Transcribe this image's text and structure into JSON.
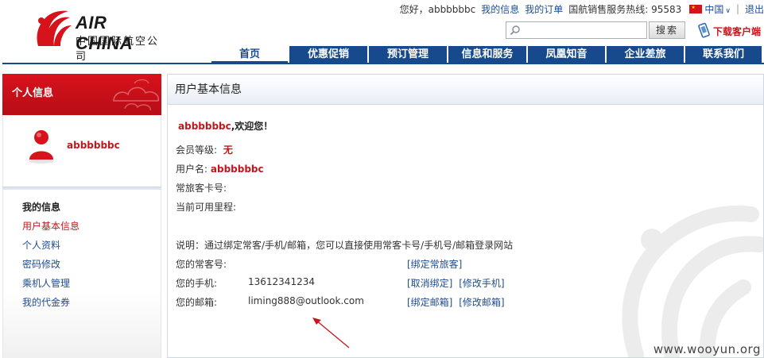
{
  "brand": {
    "name_en": "AIR CHINA",
    "name_cn": "中国国际航空公司",
    "accent": "#c5161e",
    "nav_blue": "#174a8d"
  },
  "toplinks": {
    "greeting": "您好，abbbbbbc",
    "my_info": "我的信息",
    "my_orders": "我的订单",
    "hotline": "国航销售服务热线: 95583",
    "lang": "中国",
    "sep": "|",
    "logout": "退出"
  },
  "search": {
    "placeholder": "",
    "button": "搜索"
  },
  "download": "下载客户端",
  "nav": [
    {
      "label": "首页"
    },
    {
      "label": "优惠促销"
    },
    {
      "label": "预订管理"
    },
    {
      "label": "信息和服务"
    },
    {
      "label": "凤凰知音"
    },
    {
      "label": "企业差旅"
    },
    {
      "label": "联系我们"
    }
  ],
  "sidebar": {
    "header": "个人信息",
    "username": "abbbbbbc",
    "menu_title": "我的信息",
    "items": [
      {
        "label": "用户基本信息"
      },
      {
        "label": "个人资料"
      },
      {
        "label": "密码修改"
      },
      {
        "label": "乘机人管理"
      },
      {
        "label": "我的代金券"
      }
    ]
  },
  "main": {
    "title": "用户基本信息",
    "welcome_name": "abbbbbbc",
    "welcome_suffix": ",欢迎您！",
    "level_label": "会员等级:",
    "level_value": "无",
    "username_label": "用户名:",
    "username_value": "abbbbbbc",
    "card_label": "常旅客卡号:",
    "miles_label": "当前可用里程:",
    "note": "说明：通过绑定常客/手机/邮箱，您可以直接使用常客卡号/手机号/邮箱登录网站",
    "bind_rows": [
      {
        "label": "您的常客号:",
        "value": "",
        "actions": [
          "[绑定常旅客]"
        ]
      },
      {
        "label": "您的手机:",
        "value": "13612341234",
        "actions": [
          "[取消绑定]",
          "[修改手机]"
        ]
      },
      {
        "label": "您的邮箱:",
        "value": "liming888@outlook.com",
        "actions": [
          "[绑定邮箱]",
          "[修改邮箱]"
        ]
      }
    ]
  },
  "watermark": "www.wooyun.org"
}
